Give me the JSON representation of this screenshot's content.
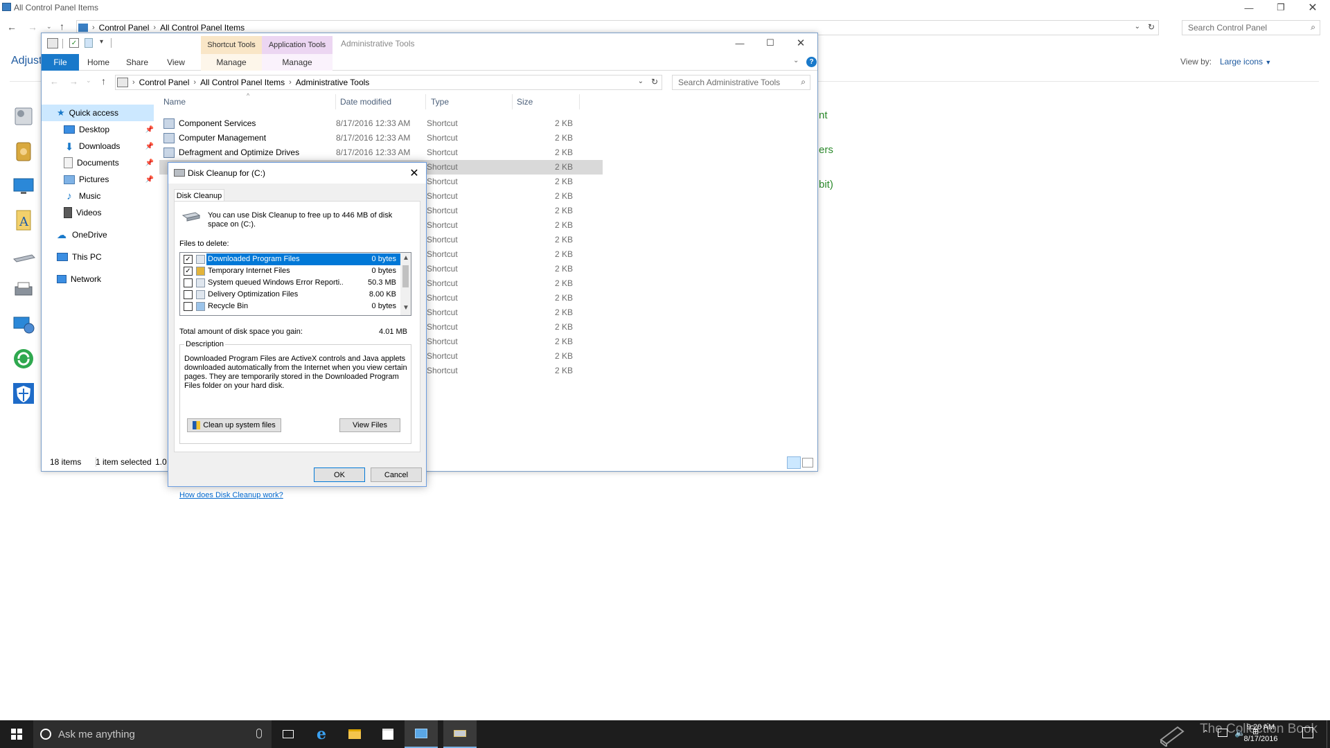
{
  "control_panel": {
    "title": "All Control Panel Items",
    "crumbs": [
      "Control Panel",
      "All Control Panel Items"
    ],
    "search_placeholder": "Search Control Panel",
    "heading": "Adjust",
    "view_by_label": "View by:",
    "view_by_value": "Large icons",
    "partial_items": [
      "nt",
      "ers",
      "bit)"
    ]
  },
  "explorer": {
    "context_tabs": [
      "Shortcut Tools",
      "Application Tools"
    ],
    "window_title": "Administrative Tools",
    "ribbon_tabs": [
      "File",
      "Home",
      "Share",
      "View",
      "Manage",
      "Manage"
    ],
    "crumbs": [
      "Control Panel",
      "All Control Panel Items",
      "Administrative Tools"
    ],
    "search_placeholder": "Search Administrative Tools",
    "nav": {
      "quick_access": "Quick access",
      "desktop": "Desktop",
      "downloads": "Downloads",
      "documents": "Documents",
      "pictures": "Pictures",
      "music": "Music",
      "videos": "Videos",
      "onedrive": "OneDrive",
      "this_pc": "This PC",
      "network": "Network"
    },
    "columns": {
      "name": "Name",
      "date": "Date modified",
      "type": "Type",
      "size": "Size"
    },
    "files": [
      {
        "name": "Component Services",
        "date": "8/17/2016 12:33 AM",
        "type": "Shortcut",
        "size": "2 KB"
      },
      {
        "name": "Computer Management",
        "date": "8/17/2016 12:33 AM",
        "type": "Shortcut",
        "size": "2 KB"
      },
      {
        "name": "Defragment and Optimize Drives",
        "date": "8/17/2016 12:33 AM",
        "type": "Shortcut",
        "size": "2 KB"
      }
    ],
    "hidden_rows": [
      {
        "type": "Shortcut",
        "size": "2 KB"
      },
      {
        "type": "Shortcut",
        "size": "2 KB"
      },
      {
        "type": "Shortcut",
        "size": "2 KB"
      },
      {
        "type": "Shortcut",
        "size": "2 KB"
      },
      {
        "type": "Shortcut",
        "size": "2 KB"
      },
      {
        "type": "Shortcut",
        "size": "2 KB"
      },
      {
        "type": "Shortcut",
        "size": "2 KB"
      },
      {
        "type": "Shortcut",
        "size": "2 KB"
      },
      {
        "type": "Shortcut",
        "size": "2 KB"
      },
      {
        "type": "Shortcut",
        "size": "2 KB"
      },
      {
        "type": "Shortcut",
        "size": "2 KB"
      },
      {
        "type": "Shortcut",
        "size": "2 KB"
      },
      {
        "type": "Shortcut",
        "size": "2 KB"
      },
      {
        "type": "Shortcut",
        "size": "2 KB"
      },
      {
        "type": "Shortcut",
        "size": "2 KB"
      }
    ],
    "status_items": "18 items",
    "status_selected": "1 item selected",
    "status_size": "1.0"
  },
  "dialog": {
    "title": "Disk Cleanup for  (C:)",
    "tab": "Disk Cleanup",
    "intro": "You can use Disk Cleanup to free up to 446 MB of disk space on  (C:).",
    "files_label": "Files to delete:",
    "files": [
      {
        "name": "Downloaded Program Files",
        "size": "0 bytes",
        "checked": true
      },
      {
        "name": "Temporary Internet Files",
        "size": "0 bytes",
        "checked": true
      },
      {
        "name": "System queued Windows Error Reporti...",
        "size": "50.3 MB",
        "checked": false
      },
      {
        "name": "Delivery Optimization Files",
        "size": "8.00 KB",
        "checked": false
      },
      {
        "name": "Recycle Bin",
        "size": "0 bytes",
        "checked": false
      }
    ],
    "total_label": "Total amount of disk space you gain:",
    "total_value": "4.01 MB",
    "description_label": "Description",
    "description": "Downloaded Program Files are ActiveX controls and Java applets downloaded automatically from the Internet when you view certain pages. They are temporarily stored in the Downloaded Program Files folder on your hard disk.",
    "cleanup_system_button": "Clean up system files",
    "view_files_button": "View Files",
    "help_link": "How does Disk Cleanup work?",
    "ok": "OK",
    "cancel": "Cancel"
  },
  "taskbar": {
    "search_placeholder": "Ask me anything",
    "time": "9:20 AM",
    "date": "8/17/2016",
    "watermark": "The Collection Book"
  }
}
